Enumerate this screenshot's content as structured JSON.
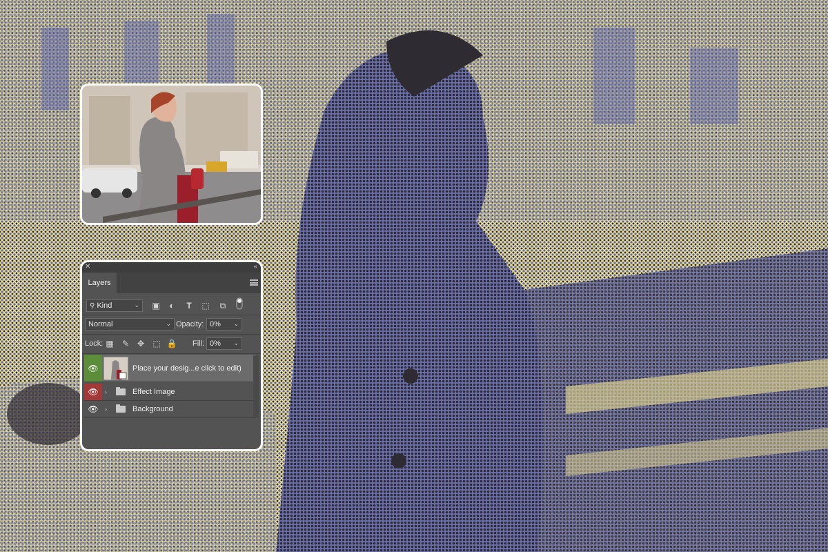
{
  "colors": {
    "halftone_yellow": "#ebde96",
    "halftone_blue": "#5b64a6",
    "halftone_dark": "#2c2a2e",
    "panel_bg": "#535353",
    "selected_eye_green": "#5c8d3a",
    "effect_eye_red": "#a33a3a"
  },
  "layers_panel": {
    "tab_label": "Layers",
    "filter_label": "Kind",
    "blend_mode": "Normal",
    "opacity_label": "Opacity:",
    "opacity_value": "0%",
    "lock_label": "Lock:",
    "fill_label": "Fill:",
    "fill_value": "0%",
    "layers": [
      {
        "name": "Place your desig...e click to edit)",
        "type": "smart-object",
        "selected": true,
        "eye_color": "green"
      },
      {
        "name": "Effect Image",
        "type": "group",
        "selected": false,
        "eye_color": "red"
      },
      {
        "name": "Background",
        "type": "group",
        "selected": false,
        "eye_color": "none"
      }
    ]
  }
}
